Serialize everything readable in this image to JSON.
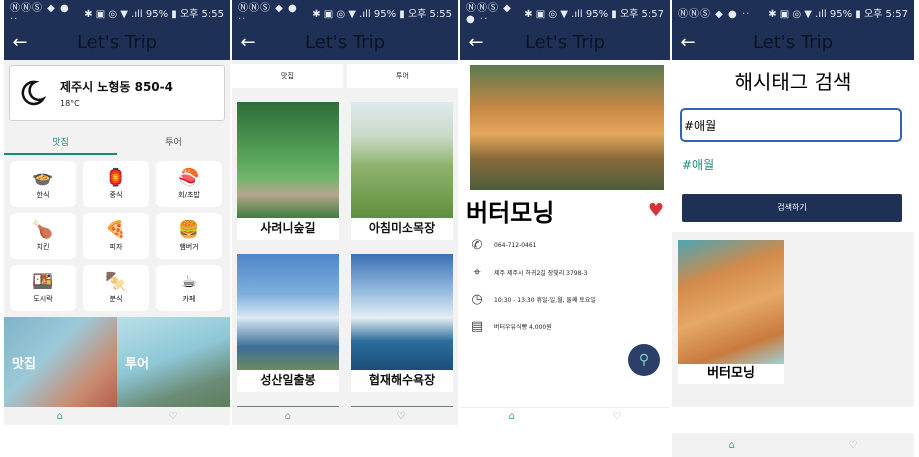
{
  "statusbar": [
    {
      "left": "ⓃⓃⓈ ◆ ●  ··",
      "right": "✱ ▣ ◎ ▼ .ıll 95% ▮ 오후 5:55"
    },
    {
      "left": "ⓃⓃⓈ ◆ ●  ··",
      "right": "✱ ▣ ◎ ▼ .ıll 95% ▮ 오후 5:55"
    },
    {
      "left": "ⓃⓃⓈ ◆ ●  ··",
      "right": "✱ ▣ ◎ ▼ .ıll 95% ▮ 오후 5:57"
    },
    {
      "left": "ⓃⓃⓈ ◆ ●  ··",
      "right": "✱ ▣ ◎ ▼ .ıll 95% ▮ 오후 5:57"
    }
  ],
  "app": {
    "title": "Let's Trip",
    "back": "←"
  },
  "s1": {
    "weather": {
      "address": "제주시 노형동 850-4",
      "temp": "18°C"
    },
    "tabs": [
      "맛집",
      "투어"
    ],
    "categories": [
      {
        "icon": "🍲",
        "label": "한식"
      },
      {
        "icon": "🏮",
        "label": "중식"
      },
      {
        "icon": "🍣",
        "label": "회/초밥"
      },
      {
        "icon": "🍗",
        "label": "치킨"
      },
      {
        "icon": "🍕",
        "label": "피자"
      },
      {
        "icon": "🍔",
        "label": "햄버거"
      },
      {
        "icon": "🍱",
        "label": "도시락"
      },
      {
        "icon": "🍢",
        "label": "분식"
      },
      {
        "icon": "☕",
        "label": "카페"
      }
    ],
    "banners": [
      "맛집",
      "투어"
    ]
  },
  "s2": {
    "tabs": [
      "맛집",
      "투어"
    ],
    "places": [
      "사려니숲길",
      "아침미소목장",
      "성산일출봉",
      "협재해수욕장"
    ]
  },
  "s3": {
    "name": "버터모닝",
    "heart": "♥",
    "phone": "064-712-0461",
    "address": "제주 제주시 하귀2길 장빛리 3798-3",
    "hours": "10:30 - 13:30 휴일-일,월, 둘째 토요일",
    "menu": "버터우유식빵 4,000원",
    "icons": {
      "phone": "✆",
      "location": "⌖",
      "clock": "◷",
      "map": "▤",
      "fab": "⚲"
    }
  },
  "s4": {
    "title": "해시태그 검색",
    "input_value": "#애월",
    "suggestion": "#애월",
    "button": "검색하기",
    "result": "버터모닝"
  },
  "nav": {
    "home": "⌂",
    "fav": "♡"
  }
}
